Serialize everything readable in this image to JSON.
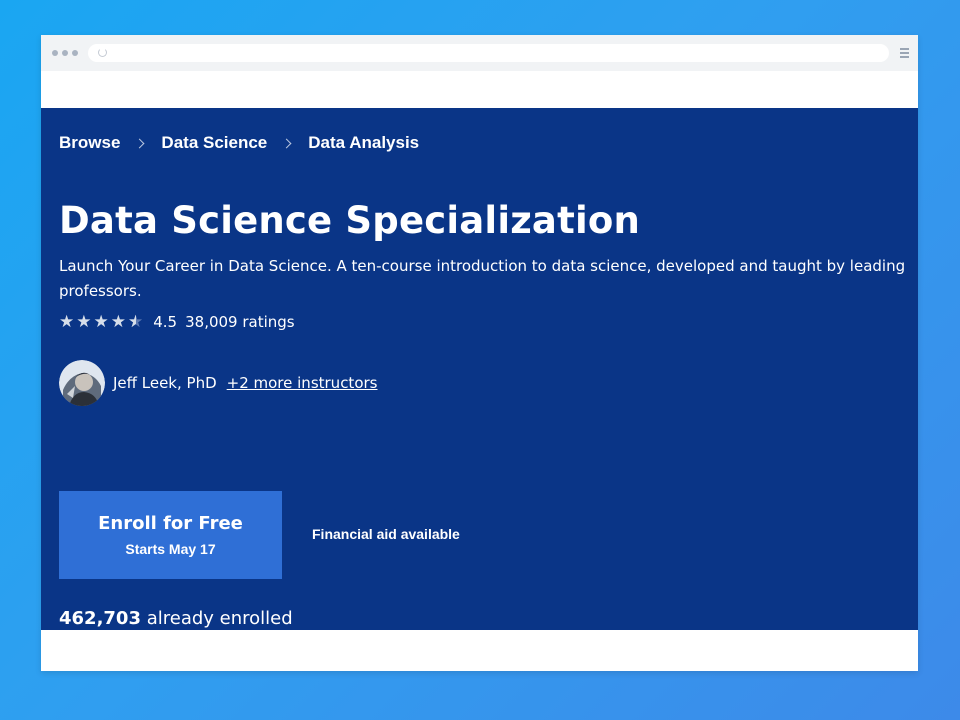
{
  "colors": {
    "background_gradient_start": "#1aa6f2",
    "background_gradient_end": "#3d8ae9",
    "hero_background": "#0a3587",
    "enroll_button": "#2f6fd6",
    "window_chrome": "#f1f3f5"
  },
  "browser": {
    "dots_icon": "three-dots-icon",
    "reload_icon": "reload-icon",
    "menu_icon": "hamburger-menu-icon"
  },
  "breadcrumb": {
    "items": [
      {
        "label": "Browse"
      },
      {
        "label": "Data Science"
      },
      {
        "label": "Data Analysis"
      }
    ],
    "separator_icon": "chevron-right-icon"
  },
  "course": {
    "title": "Data Science Specialization",
    "subtitle": "Launch Your Career in Data Science. A ten-course introduction to data science, developed and taught by leading professors.",
    "rating": {
      "stars": 4.5,
      "value": "4.5",
      "count": "38,009 ratings"
    },
    "instructor": {
      "avatar_icon": "instructor-avatar",
      "name": "Jeff Leek, PhD",
      "more_link": "+2 more instructors"
    },
    "enroll": {
      "label": "Enroll for Free",
      "sublabel": "Starts May 17"
    },
    "financial_aid": "Financial aid available",
    "enrolled": {
      "count": "462,703",
      "suffix": "already enrolled"
    }
  }
}
